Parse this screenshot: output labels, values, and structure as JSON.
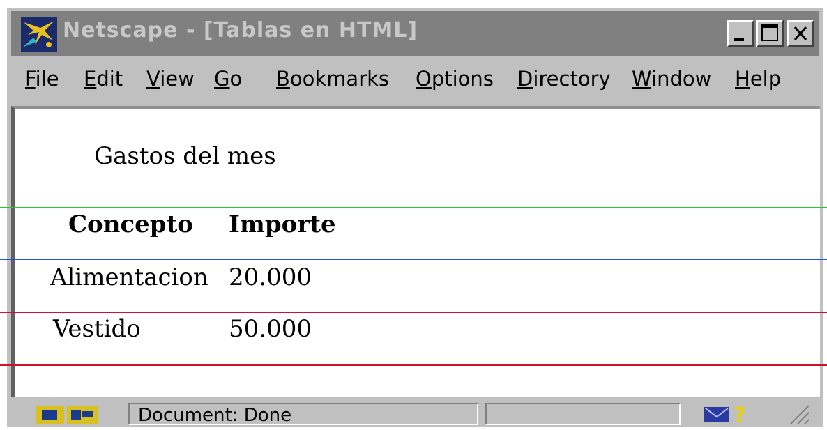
{
  "window": {
    "title": "Netscape - [Tablas en HTML]"
  },
  "menu": [
    {
      "label": "File",
      "name": "file"
    },
    {
      "label": "Edit",
      "name": "edit"
    },
    {
      "label": "View",
      "name": "view"
    },
    {
      "label": "Go",
      "name": "go"
    },
    {
      "label": "Bookmarks",
      "name": "bookmarks"
    },
    {
      "label": "Options",
      "name": "options"
    },
    {
      "label": "Directory",
      "name": "directory"
    },
    {
      "label": "Window",
      "name": "window"
    },
    {
      "label": "Help",
      "name": "help"
    }
  ],
  "page": {
    "caption": "Gastos del mes",
    "headers": [
      "Concepto",
      "Importe"
    ],
    "rows": [
      {
        "concepto": "Alimentacion",
        "importe": "20.000"
      },
      {
        "concepto": "Vestido",
        "importe": "50.000"
      }
    ]
  },
  "status": {
    "text": "Document: Done"
  },
  "colors": {
    "titlebar": "#808080",
    "window": "#c0c0c0",
    "line_green": "#22cc22",
    "line_blue": "#2255dd",
    "line_red": "#cc1133"
  },
  "icons": [
    "netscape-logo-icon",
    "minimize-icon",
    "maximize-icon",
    "close-icon",
    "security-key-icon",
    "mail-icon",
    "help-question-icon",
    "resize-grip-icon"
  ]
}
